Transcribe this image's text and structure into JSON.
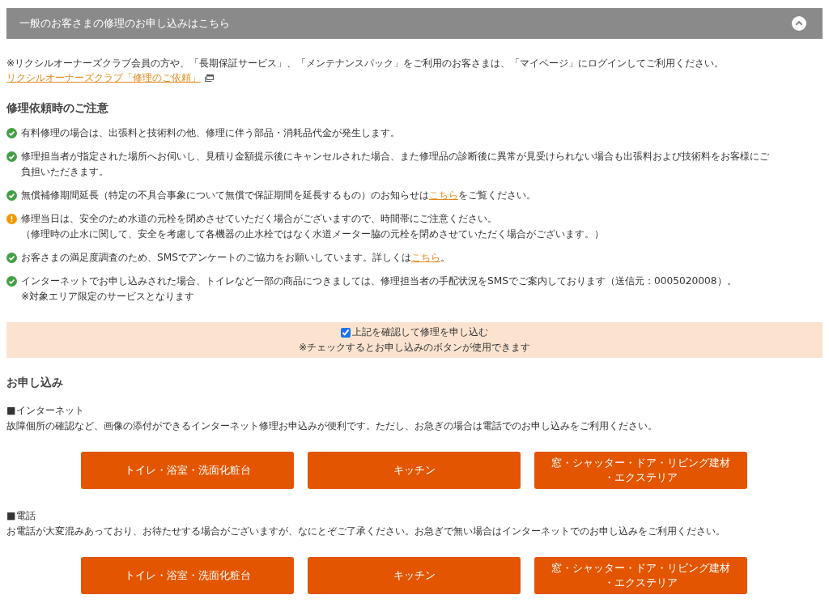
{
  "accordion": {
    "title": "一般のお客さまの修理のお申し込みはこちら",
    "expanded": true
  },
  "intro": {
    "text": "※リクシルオーナーズクラブ会員の方や、「長期保証サービス」、「メンテナンスパック」をご利用のお客さまは、「マイページ」にログインしてご利用ください。",
    "link": "リクシルオーナーズクラブ「修理のご依頼」"
  },
  "notes": {
    "heading": "修理依頼時のご注意",
    "items": [
      {
        "kind": "check",
        "lines": [
          [
            {
              "text": "有料修理の場合は、出張料と技術料の他、修理に伴う部品・消耗品代金が発生します。"
            }
          ]
        ]
      },
      {
        "kind": "check",
        "lines": [
          [
            {
              "text": "修理担当者が指定された場所へお伺いし、見積り金額提示後にキャンセルされた場合、また修理品の診断後に異常が見受けられない場合も出張料および技術料をお客様にご"
            }
          ],
          [
            {
              "text": "負担いただきます。"
            }
          ]
        ]
      },
      {
        "kind": "check",
        "lines": [
          [
            {
              "text": "無償補修期間延長（特定の不具合事象について無償で保証期間を延長するもの）のお知らせは"
            },
            {
              "text": "こちら",
              "link": true
            },
            {
              "text": "をご覧ください。"
            }
          ]
        ]
      },
      {
        "kind": "warning",
        "lines": [
          [
            {
              "text": "修理当日は、安全のため水道の元栓を閉めさせていただく場合がございますので、時間帯にご注意ください。"
            }
          ],
          [
            {
              "text": "（修理時の止水に関して、安全を考慮して各機器の止水栓ではなく水道メーター脇の元栓を閉めさせていただく場合がございます。）"
            }
          ]
        ]
      },
      {
        "kind": "check",
        "lines": [
          [
            {
              "text": "お客さまの満足度調査のため、SMSでアンケートのご協力をお願いしています。詳しくは"
            },
            {
              "text": "こちら",
              "link": true
            },
            {
              "text": "。"
            }
          ]
        ]
      },
      {
        "kind": "check",
        "lines": [
          [
            {
              "text": "インターネットでお申し込みされた場合、トイレなど一部の商品につきましては、修理担当者の手配状況をSMSでご案内しております（送信元：0005020008）。"
            }
          ],
          [
            {
              "text": "※対象エリア限定のサービスとなります"
            }
          ]
        ]
      }
    ]
  },
  "confirm": {
    "label": "上記を確認して修理を申し込む",
    "checked": true,
    "note": "※チェックするとお申し込みのボタンが使用できます"
  },
  "application": {
    "heading": "お申し込み",
    "groups": [
      {
        "title": "■インターネット",
        "description": "故障個所の確認など、画像の添付ができるインターネット修理お申込みが便利です。ただし、お急ぎの場合は電話でのお申し込みをご利用ください。",
        "buttons": [
          [
            "トイレ・浴室・洗面化粧台"
          ],
          [
            "キッチン"
          ],
          [
            "窓・シャッター・ドア・リビング建材",
            "・エクステリア"
          ]
        ]
      },
      {
        "title": "■電話",
        "description": "お電話が大変混みあっており、お待たせする場合がございますが、なにとぞご了承ください。お急ぎで無い場合はインターネットでのお申し込みをご利用ください。",
        "buttons": [
          [
            "トイレ・浴室・洗面化粧台"
          ],
          [
            "キッチン"
          ],
          [
            "窓・シャッター・ドア・リビング建材",
            "・エクステリア"
          ]
        ]
      }
    ]
  }
}
